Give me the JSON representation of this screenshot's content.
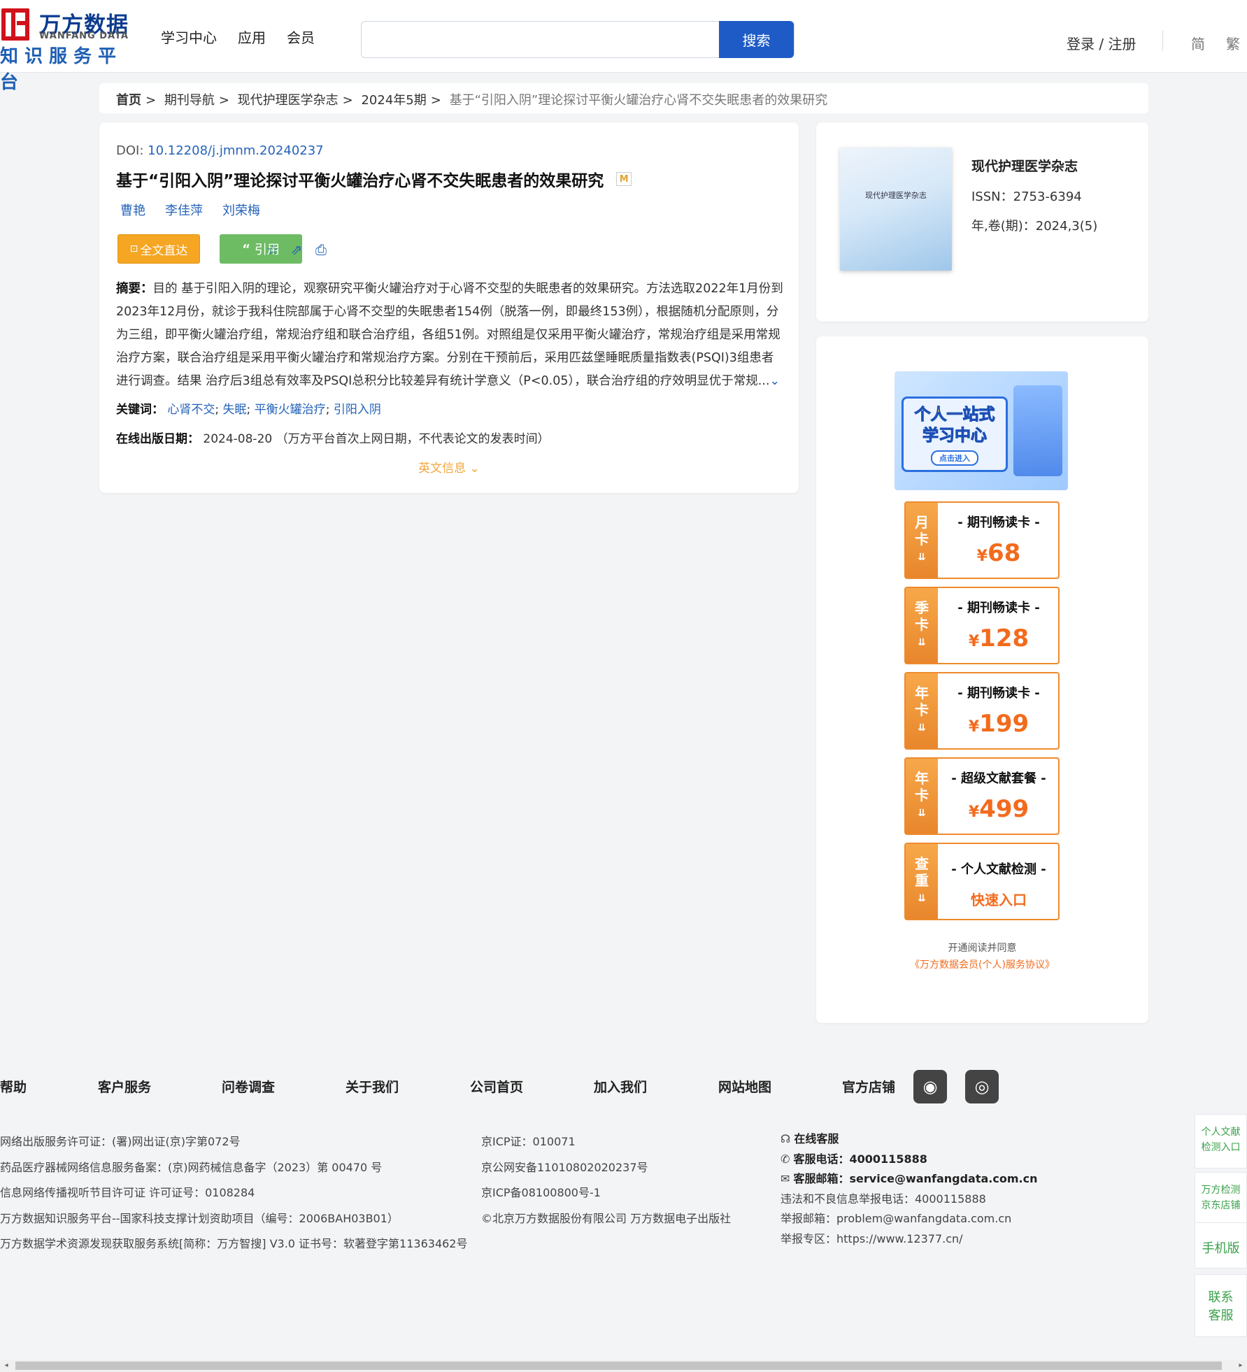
{
  "header": {
    "logo_cn": "万方数据",
    "logo_en": "WANFANG DATA",
    "logo_sub": "知识服务平台",
    "nav": [
      "学习中心",
      "应用",
      "会员"
    ],
    "search_placeholder": "",
    "search_button": "搜索",
    "login": "登录 / 注册",
    "lang_simplified": "简",
    "lang_traditional": "繁"
  },
  "breadcrumb": [
    "首页",
    "期刊导航",
    "现代护理医学杂志",
    "2024年5期",
    "基于“引阳入阴”理论探讨平衡火罐治疗心肾不交失眠患者的效果研究"
  ],
  "article": {
    "doi_label": "DOI:",
    "doi": "10.12208/j.jmnm.20240237",
    "title": "基于“引阳入阴”理论探讨平衡火罐治疗心肾不交失眠患者的效果研究",
    "badge": "M",
    "authors": [
      "曹艳",
      "李佳萍",
      "刘荣梅"
    ],
    "btn_fulltext": "全文直达",
    "btn_cite": "引用",
    "abstract_label": "摘要：",
    "abstract": "目的 基于引阳入阴的理论，观察研究平衡火罐治疗对于心肾不交型的失眠患者的效果研究。方法选取2022年1月份到2023年12月份，就诊于我科住院部属于心肾不交型的失眠患者154例（脱落一例，即最终153例），根据随机分配原则，分为三组，即平衡火罐治疗组，常规治疗组和联合治疗组，各组51例。对照组是仅采用平衡火罐治疗，常规治疗组是采用常规治疗方案，联合治疗组是采用平衡火罐治疗和常规治疗方案。分别在干预前后，采用匹兹堡睡眠质量指数表(PSQI)3组患者进行调查。结果 治疗后3组总有效率及PSQI总积分比较差异有统计学意义（P<0.05），联合治疗组的疗效明显优于常规...",
    "keywords_label": "关键词：",
    "keywords": [
      "心肾不交",
      "失眠",
      "平衡火罐治疗",
      "引阳入阴"
    ],
    "online_label": "在线出版日期：",
    "online_date": "2024-08-20",
    "online_note": "（万方平台首次上网日期，不代表论文的发表时间）",
    "english_info": "英文信息"
  },
  "journal": {
    "cover_text": "现代护理医学杂志",
    "name": "现代护理医学杂志",
    "issn": "ISSN：2753-6394",
    "volume": "年,卷(期)：2024,3(5)"
  },
  "promo": {
    "banner_line1": "个人一站式",
    "banner_line2": "学习中心",
    "banner_enter": "点击进入",
    "offers": [
      {
        "tag": "月卡",
        "title": "- 期刊畅读卡 -",
        "price": "68"
      },
      {
        "tag": "季卡",
        "title": "- 期刊畅读卡 -",
        "price": "128"
      },
      {
        "tag": "年卡",
        "title": "- 期刊畅读卡 -",
        "price": "199"
      },
      {
        "tag": "年卡",
        "title": "- 超级文献套餐 -",
        "price": "499"
      },
      {
        "tag": "查重",
        "title": "- 个人文献检测 -",
        "link": "快速入口"
      }
    ],
    "currency": "¥",
    "agree_text": "开通阅读并同意",
    "agree_link": "《万方数据会员(个人)服务协议》"
  },
  "footer": {
    "nav": [
      "帮助",
      "客户服务",
      "问卷调查",
      "关于我们",
      "公司首页",
      "加入我们",
      "网站地图",
      "官方店铺"
    ],
    "col1": [
      "网络出版服务许可证：(署)网出证(京)字第072号",
      "药品医疗器械网络信息服务备案：(京)网药械信息备字（2023）第 00470 号",
      "信息网络传播视听节目许可证 许可证号：0108284",
      "万方数据知识服务平台--国家科技支撑计划资助项目（编号：2006BAH03B01）",
      "万方数据学术资源发现获取服务系统[简称：万方智搜] V3.0 证书号：软著登字第11363462号"
    ],
    "col2": [
      "京ICP证：010071",
      "京公网安备11010802020237号",
      "京ICP备08100800号-1",
      "©北京万方数据股份有限公司 万方数据电子出版社"
    ],
    "online_service": "在线客服",
    "phone_label": "客服电话：",
    "phone": "4000115888",
    "email_label": "客服邮箱：",
    "email": "service@wanfangdata.com.cn",
    "report_phone": "违法和不良信息举报电话：4000115888",
    "report_email": "举报邮箱：problem@wanfangdata.com.cn",
    "report_zone": "举报专区：https://www.12377.cn/"
  },
  "sidebar": {
    "item1": "个人文献检测入口",
    "item2": "万方检测京东店铺",
    "item3": "手机版",
    "item4": "联系客服"
  }
}
